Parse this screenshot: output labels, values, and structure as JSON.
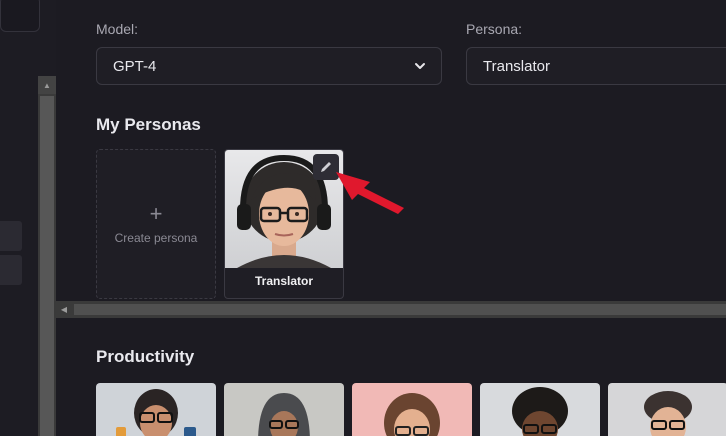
{
  "selectors": {
    "model_label": "Model:",
    "model_value": "GPT-4",
    "persona_label": "Persona:",
    "persona_value": "Translator"
  },
  "my_personas": {
    "title": "My Personas",
    "create_label": "Create persona",
    "cards": [
      {
        "name": "Translator"
      }
    ]
  },
  "productivity": {
    "title": "Productivity"
  },
  "icons": [
    "chevron-down-icon",
    "plus-icon",
    "pencil-icon",
    "red-arrow-annotation"
  ],
  "colors": {
    "background": "#1c1b22",
    "card": "#1f1e25",
    "border": "#3a3942",
    "annotation": "#e0182d"
  }
}
